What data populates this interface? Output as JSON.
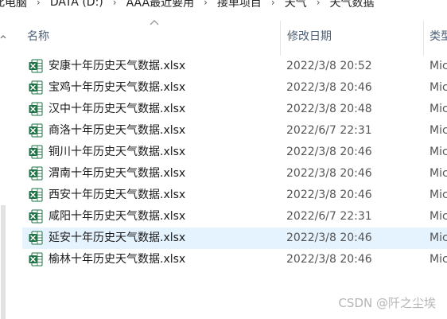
{
  "breadcrumb": {
    "items": [
      "此电脑",
      "DATA (D:)",
      "AAA最近要用",
      "接单项目",
      "天气",
      "天气数据"
    ],
    "separator": "›"
  },
  "columns": {
    "name": "名称",
    "date_modified": "修改日期",
    "type": "类型"
  },
  "files": [
    {
      "name": "安康十年历史天气数据.xlsx",
      "date": "2022/3/8 20:52",
      "type": "Mic",
      "icon": "excel-file-icon"
    },
    {
      "name": "宝鸡十年历史天气数据.xlsx",
      "date": "2022/3/8 20:46",
      "type": "Mic",
      "icon": "excel-file-icon"
    },
    {
      "name": "汉中十年历史天气数据.xlsx",
      "date": "2022/3/8 20:48",
      "type": "Mic",
      "icon": "excel-file-icon"
    },
    {
      "name": "商洛十年历史天气数据.xlsx",
      "date": "2022/6/7 22:31",
      "type": "Mic",
      "icon": "excel-file-icon"
    },
    {
      "name": "铜川十年历史天气数据.xlsx",
      "date": "2022/3/8 20:46",
      "type": "Mic",
      "icon": "excel-file-icon"
    },
    {
      "name": "渭南十年历史天气数据.xlsx",
      "date": "2022/3/8 20:46",
      "type": "Mic",
      "icon": "excel-file-icon"
    },
    {
      "name": "西安十年历史天气数据.xlsx",
      "date": "2022/3/8 20:46",
      "type": "Mic",
      "icon": "excel-file-icon"
    },
    {
      "name": "咸阳十年历史天气数据.xlsx",
      "date": "2022/6/7 22:31",
      "type": "Mic",
      "icon": "excel-file-icon"
    },
    {
      "name": "延安十年历史天气数据.xlsx",
      "date": "2022/3/8 20:46",
      "type": "Mic",
      "icon": "excel-file-icon",
      "selected": true
    },
    {
      "name": "榆林十年历史天气数据.xlsx",
      "date": "2022/3/8 20:46",
      "type": "Mic",
      "icon": "excel-file-icon"
    }
  ],
  "watermark": "CSDN @阡之尘埃",
  "colors": {
    "excel_green": "#1e7145",
    "selection": "#e5f3ff",
    "header_text": "#4c607a"
  }
}
